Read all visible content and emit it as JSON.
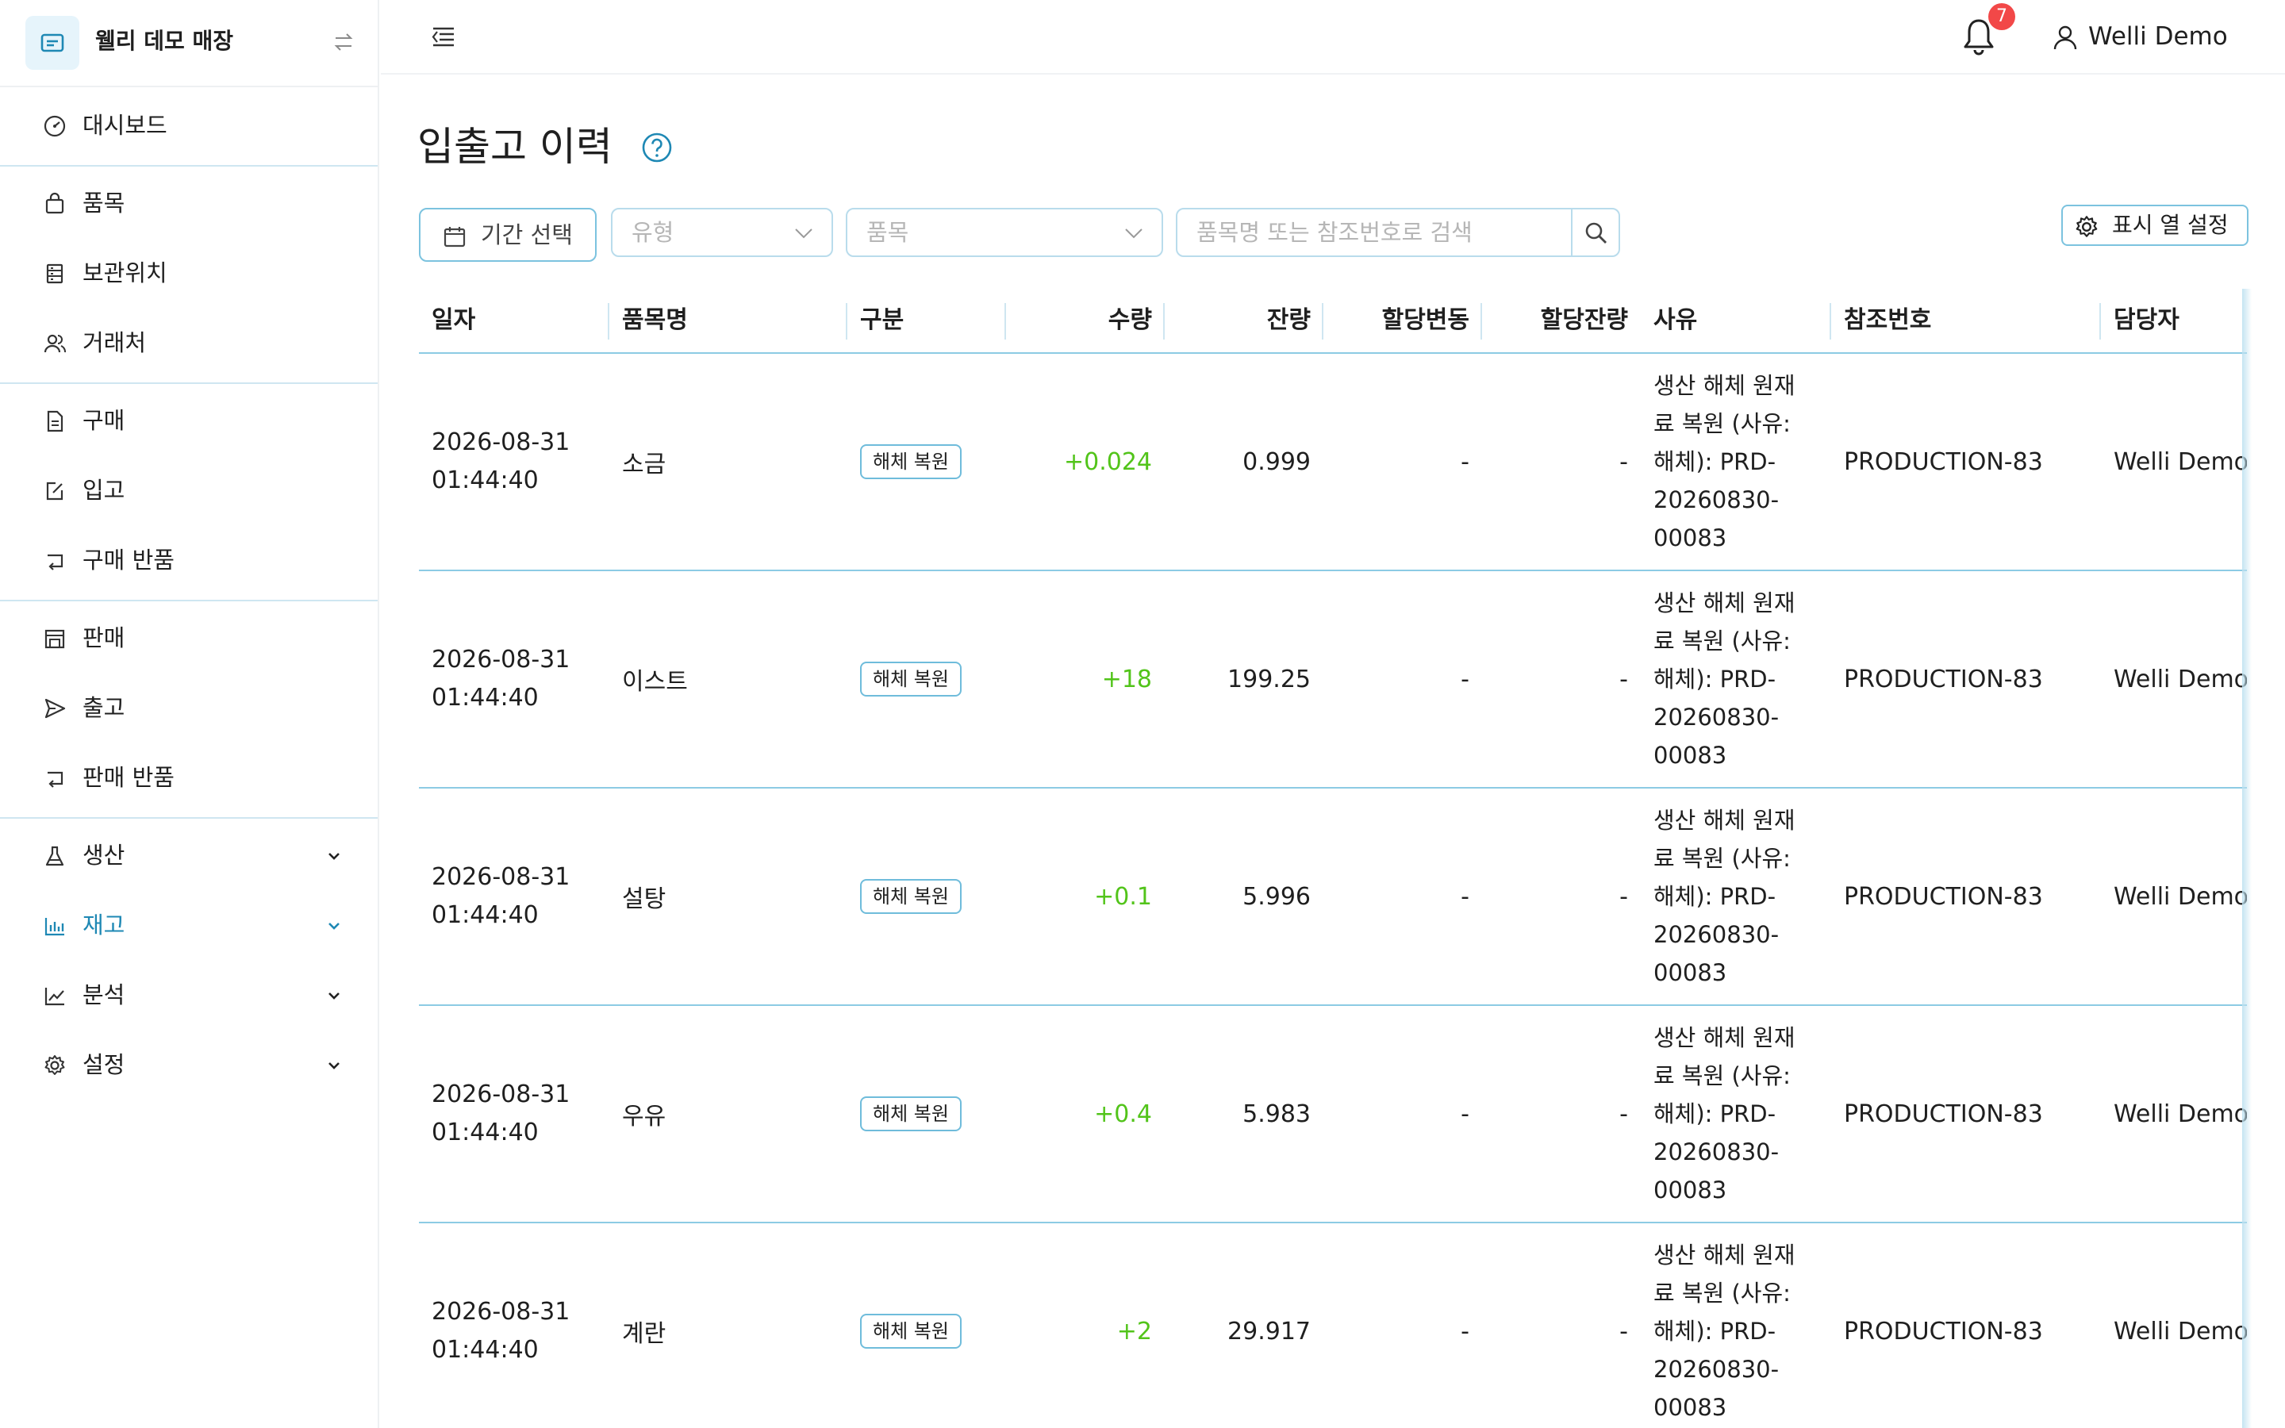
{
  "store": {
    "name": "웰리 데모 매장"
  },
  "nav": {
    "dashboard": "대시보드",
    "items": "품목",
    "locations": "보관위치",
    "partners": "거래처",
    "purchase": "구매",
    "inbound": "입고",
    "purchase_return": "구매 반품",
    "sales": "판매",
    "outbound": "출고",
    "sales_return": "판매 반품",
    "production": "생산",
    "inventory": "재고",
    "analytics": "분석",
    "settings": "설정"
  },
  "topbar": {
    "notification_count": "7",
    "user_name": "Welli Demo"
  },
  "page": {
    "title": "입출고 이력"
  },
  "filters": {
    "date_label": "기간 선택",
    "type_placeholder": "유형",
    "item_placeholder": "품목",
    "search_placeholder": "품목명 또는 참조번호로 검색",
    "column_settings_label": "표시 열 설정"
  },
  "table": {
    "columns": [
      "일자",
      "품목명",
      "구분",
      "수량",
      "잔량",
      "할당변동",
      "할당잔량",
      "사유",
      "참조번호",
      "담당자"
    ],
    "rows": [
      {
        "date": "2026-08-31\n01:44:40",
        "item": "소금",
        "type": "해체 복원",
        "qty": "+0.024",
        "balance": "0.999",
        "alloc_change": "-",
        "alloc_balance": "-",
        "reason": "생산 해체 원재\n료 복원 (사유:\n해체): PRD-\n20260830-\n00083",
        "ref": "PRODUCTION-83",
        "manager": "Welli Demo"
      },
      {
        "date": "2026-08-31\n01:44:40",
        "item": "이스트",
        "type": "해체 복원",
        "qty": "+18",
        "balance": "199.25",
        "alloc_change": "-",
        "alloc_balance": "-",
        "reason": "생산 해체 원재\n료 복원 (사유:\n해체): PRD-\n20260830-\n00083",
        "ref": "PRODUCTION-83",
        "manager": "Welli Demo"
      },
      {
        "date": "2026-08-31\n01:44:40",
        "item": "설탕",
        "type": "해체 복원",
        "qty": "+0.1",
        "balance": "5.996",
        "alloc_change": "-",
        "alloc_balance": "-",
        "reason": "생산 해체 원재\n료 복원 (사유:\n해체): PRD-\n20260830-\n00083",
        "ref": "PRODUCTION-83",
        "manager": "Welli Demo"
      },
      {
        "date": "2026-08-31\n01:44:40",
        "item": "우유",
        "type": "해체 복원",
        "qty": "+0.4",
        "balance": "5.983",
        "alloc_change": "-",
        "alloc_balance": "-",
        "reason": "생산 해체 원재\n료 복원 (사유:\n해체): PRD-\n20260830-\n00083",
        "ref": "PRODUCTION-83",
        "manager": "Welli Demo"
      },
      {
        "date": "2026-08-31\n01:44:40",
        "item": "계란",
        "type": "해체 복원",
        "qty": "+2",
        "balance": "29.917",
        "alloc_change": "-",
        "alloc_balance": "-",
        "reason": "생산 해체 원재\n료 복원 (사유:\n해체): PRD-\n20260830-\n00083",
        "ref": "PRODUCTION-83",
        "manager": "Welli Demo"
      }
    ]
  },
  "colors": {
    "accent": "#1e88b4",
    "positive": "#52c41a",
    "border": "#8ccbe4",
    "badge": "#f24848"
  }
}
